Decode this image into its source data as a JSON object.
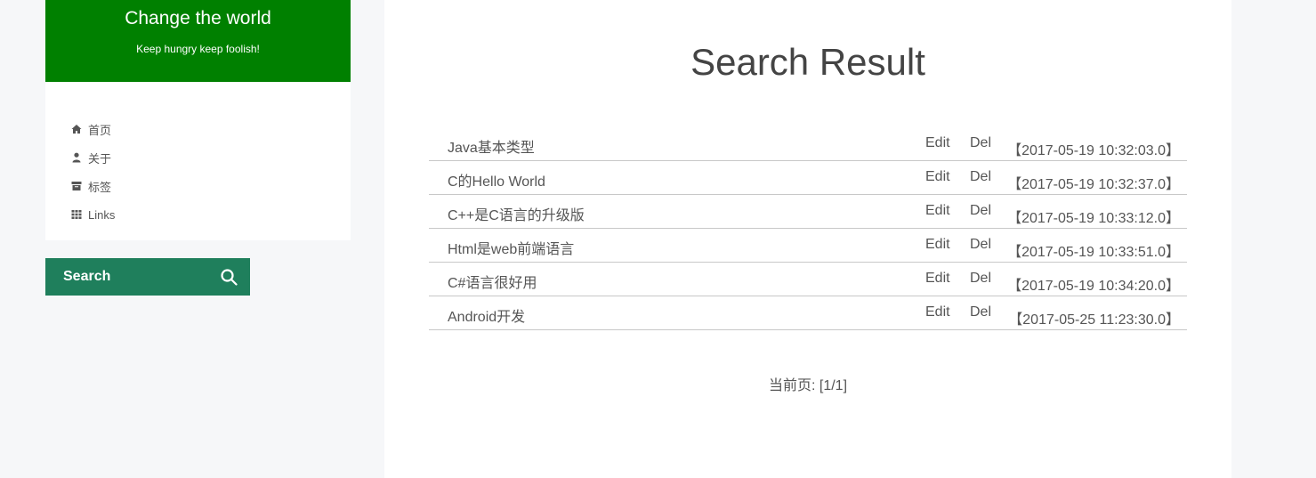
{
  "brand": {
    "title": "Change the world",
    "subtitle": "Keep hungry keep foolish!",
    "color": "#008000"
  },
  "menu": [
    {
      "icon": "home-icon",
      "label": "首页"
    },
    {
      "icon": "user-icon",
      "label": "关于"
    },
    {
      "icon": "archive-icon",
      "label": "标签"
    },
    {
      "icon": "grid-icon",
      "label": "Links"
    }
  ],
  "search": {
    "label": "Search",
    "icon": "search-icon",
    "color": "#1f7f5c"
  },
  "main": {
    "title": "Search Result",
    "edit_label": "Edit",
    "del_label": "Del",
    "results": [
      {
        "title": "Java基本类型",
        "time": "【2017-05-19 10:32:03.0】"
      },
      {
        "title": "C的Hello World",
        "time": "【2017-05-19 10:32:37.0】"
      },
      {
        "title": "C++是C语言的升级版",
        "time": "【2017-05-19 10:33:12.0】"
      },
      {
        "title": "Html是web前端语言",
        "time": "【2017-05-19 10:33:51.0】"
      },
      {
        "title": "C#语言很好用",
        "time": "【2017-05-19 10:34:20.0】"
      },
      {
        "title": "Android开发",
        "time": "【2017-05-25 11:23:30.0】"
      }
    ],
    "pager": "当前页: [1/1]"
  }
}
